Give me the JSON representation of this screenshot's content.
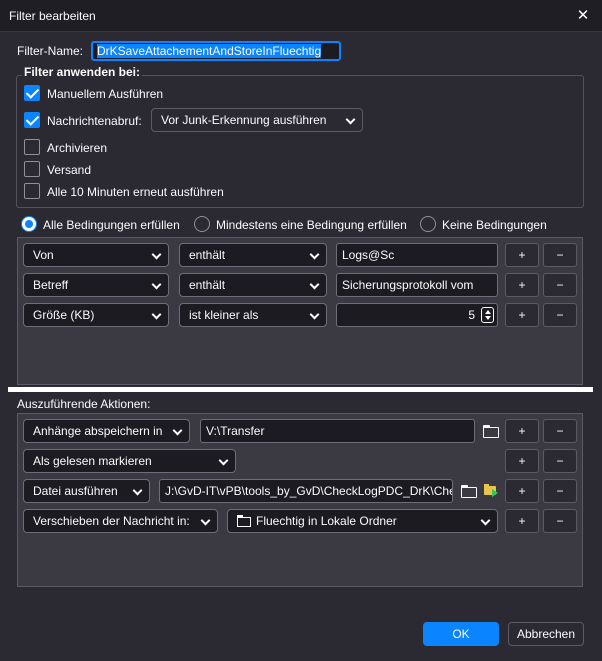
{
  "window": {
    "title": "Filter bearbeiten",
    "close_glyph": "✕"
  },
  "filter_name": {
    "label": "Filter-Name:",
    "value": "DrKSaveAttachementAndStoreInFluechtig"
  },
  "apply_group": {
    "legend": "Filter anwenden bei:",
    "manual": {
      "label": "Manuellem Ausführen",
      "checked": true
    },
    "fetch": {
      "label": "Nachrichtenabruf:",
      "checked": true,
      "timing": "Vor Junk-Erkennung ausführen"
    },
    "archive": {
      "label": "Archivieren",
      "checked": false
    },
    "send": {
      "label": "Versand",
      "checked": false
    },
    "periodic": {
      "label": "Alle 10 Minuten erneut ausführen",
      "checked": false
    }
  },
  "match_mode": {
    "all": "Alle Bedingungen erfüllen",
    "any": "Mindestens eine Bedingung erfüllen",
    "none": "Keine Bedingungen",
    "selected": "all"
  },
  "conditions": [
    {
      "field": "Von",
      "operator": "enthält",
      "value": "Logs@Sc"
    },
    {
      "field": "Betreff",
      "operator": "enthält",
      "value": "Sicherungsprotokoll vom"
    },
    {
      "field": "Größe (KB)",
      "operator": "ist kleiner als",
      "value": "5"
    }
  ],
  "actions_label": "Auszuführende Aktionen:",
  "actions": [
    {
      "action": "Anhänge abspeichern in",
      "target": "V:\\Transfer"
    },
    {
      "action": "Als gelesen markieren"
    },
    {
      "action": "Datei ausführen",
      "target": "J:\\GvD-IT\\vPB\\tools_by_GvD\\CheckLogPDC_DrK\\Chec"
    },
    {
      "action": "Verschieben der Nachricht in:",
      "target": "Fluechtig in Lokale Ordner"
    }
  ],
  "row_buttons": {
    "add": "+",
    "remove": "−"
  },
  "footer": {
    "ok": "OK",
    "cancel": "Abbrechen"
  },
  "colors": {
    "accent": "#0a84ff",
    "background": "#2b2a33",
    "panel": "#3b3a43"
  }
}
